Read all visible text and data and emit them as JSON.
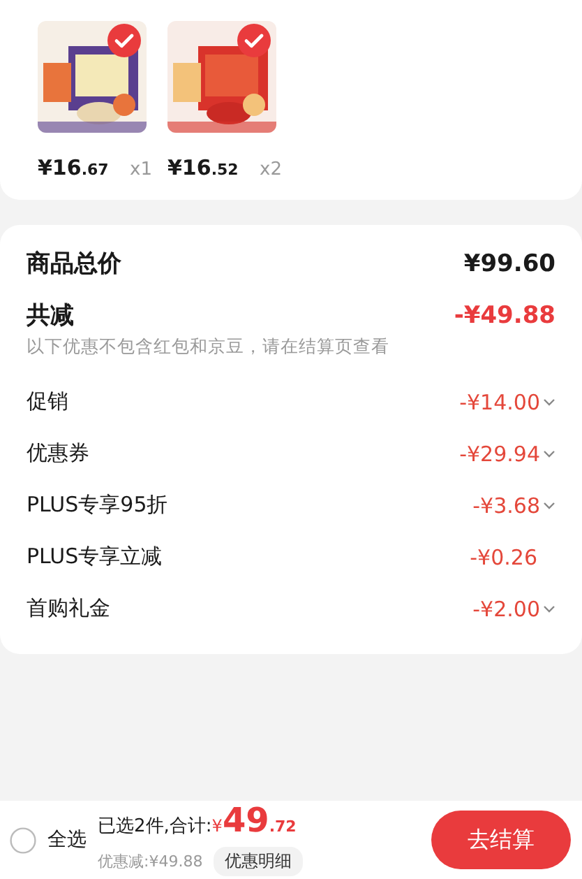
{
  "items": [
    {
      "selected": true,
      "price_main": "¥16",
      "price_decimal": ".67",
      "quantity": "x1"
    },
    {
      "selected": true,
      "price_main": "¥16",
      "price_decimal": ".52",
      "quantity": "x2"
    }
  ],
  "summary": {
    "total_label": "商品总价",
    "total_value": "¥99.60",
    "discount_label": "共减",
    "discount_value": "-¥49.88",
    "note": "以下优惠不包含红包和京豆，请在结算页查看",
    "rows": [
      {
        "label": "促销",
        "amount": "-¥14.00",
        "expandable": true
      },
      {
        "label": "优惠券",
        "amount": "-¥29.94",
        "expandable": true
      },
      {
        "label": "PLUS专享95折",
        "amount": "-¥3.68",
        "expandable": true
      },
      {
        "label": "PLUS专享立减",
        "amount": "-¥0.26",
        "expandable": false
      },
      {
        "label": "首购礼金",
        "amount": "-¥2.00",
        "expandable": true
      }
    ]
  },
  "bottom_bar": {
    "select_all": {
      "label": "全选",
      "selected": false
    },
    "selected_text": "已选2件,合计:",
    "currency": "¥",
    "total_main": "49",
    "total_decimal": ".72",
    "saved": "优惠减:¥49.88",
    "details_button": "优惠明细",
    "checkout_button": "去结算"
  }
}
